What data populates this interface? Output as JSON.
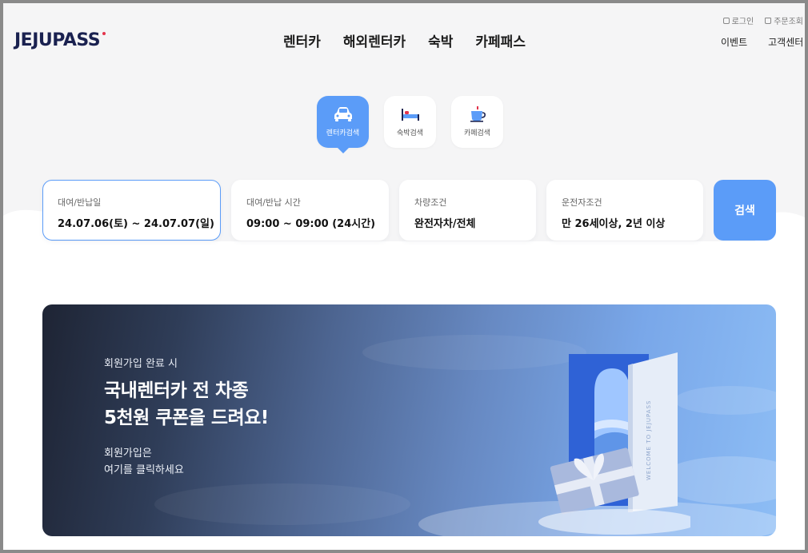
{
  "brand": {
    "logo_text": "JEJUPASS",
    "accent": "#e3334b",
    "navy": "#1a2150",
    "primary": "#5b9cf8"
  },
  "nav": {
    "items": [
      "렌터카",
      "해외렌터카",
      "숙박",
      "카페패스"
    ]
  },
  "util": {
    "login": "로그인",
    "order_lookup": "주문조회",
    "login_icon": "login-icon",
    "order_icon": "bag-icon"
  },
  "subnav": {
    "event": "이벤트",
    "support": "고객센터"
  },
  "search_tabs": [
    {
      "label": "렌터카검색",
      "icon": "car-icon",
      "active": true
    },
    {
      "label": "숙박검색",
      "icon": "bed-icon",
      "active": false
    },
    {
      "label": "카페검색",
      "icon": "cup-icon",
      "active": false
    }
  ],
  "search": {
    "fields": [
      {
        "label": "대여/반납일",
        "value": "24.07.06(토) ~ 24.07.07(일)"
      },
      {
        "label": "대여/반납 시간",
        "value": "09:00 ~ 09:00 (24시간)"
      },
      {
        "label": "차량조건",
        "value": "완전자차/전체"
      },
      {
        "label": "운전자조건",
        "value": "만 26세이상, 2년 이상"
      }
    ],
    "button": "검색"
  },
  "banner": {
    "subtitle": "회원가입 완료 시",
    "title_line1": "국내렌터카 전 차종",
    "title_line2": "5천원 쿠폰을 드려요!",
    "link_line1": "회원가입은",
    "link_line2": "여기를 클릭하세요",
    "door_text": "WELCOME TO JEJUPASS"
  }
}
